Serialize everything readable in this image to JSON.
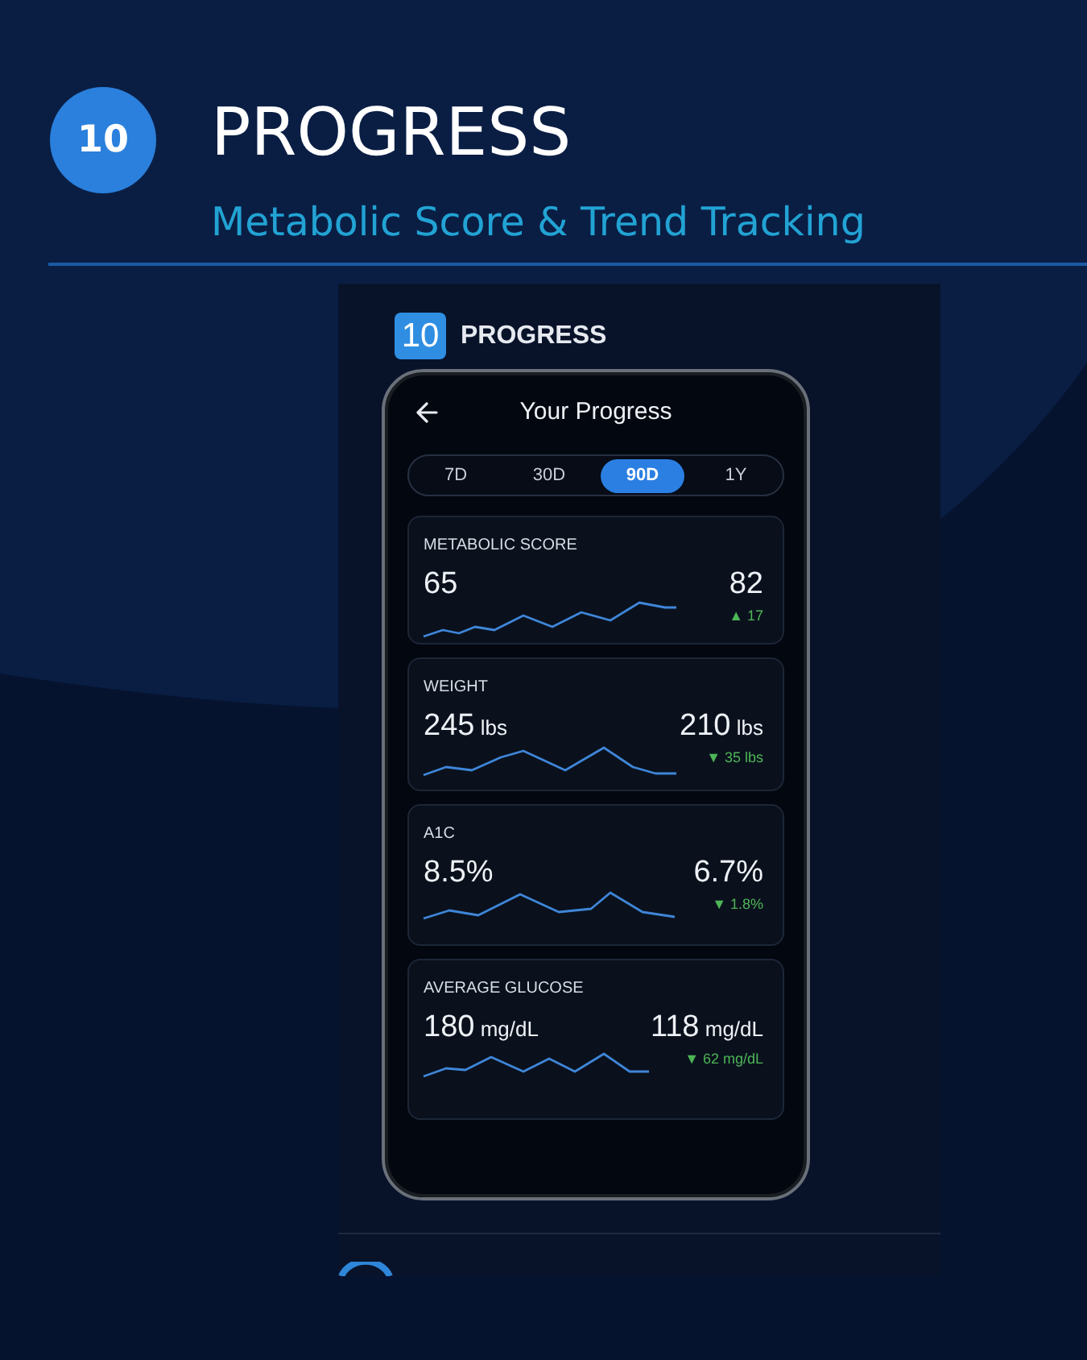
{
  "header": {
    "badge": "10",
    "title": "PROGRESS",
    "subtitle": "Metabolic Score & Trend Tracking"
  },
  "screenshot": {
    "badge": "10",
    "title": "PROGRESS",
    "screen_title": "Your Progress",
    "tabs": [
      {
        "label": "7D",
        "selected": false
      },
      {
        "label": "30D",
        "selected": false
      },
      {
        "label": "90D",
        "selected": true
      },
      {
        "label": "1Y",
        "selected": false
      }
    ],
    "metrics": [
      {
        "label": "METABOLIC SCORE",
        "start_value": "65",
        "end_value": "82",
        "change": "▲ 17"
      },
      {
        "label": "WEIGHT",
        "start_value": "245",
        "start_unit": "lbs",
        "end_value": "210",
        "end_unit": "lbs",
        "change": "▼ 35 lbs"
      },
      {
        "label": "A1C",
        "start_value": "8.5%",
        "end_value": "6.7%",
        "change": "▼ 1.8%"
      },
      {
        "label": "AVERAGE GLUCOSE",
        "start_value": "180",
        "start_unit": "mg/dL",
        "end_value": "118",
        "end_unit": "mg/dL",
        "change": "▼ 62 mg/dL"
      }
    ]
  }
}
